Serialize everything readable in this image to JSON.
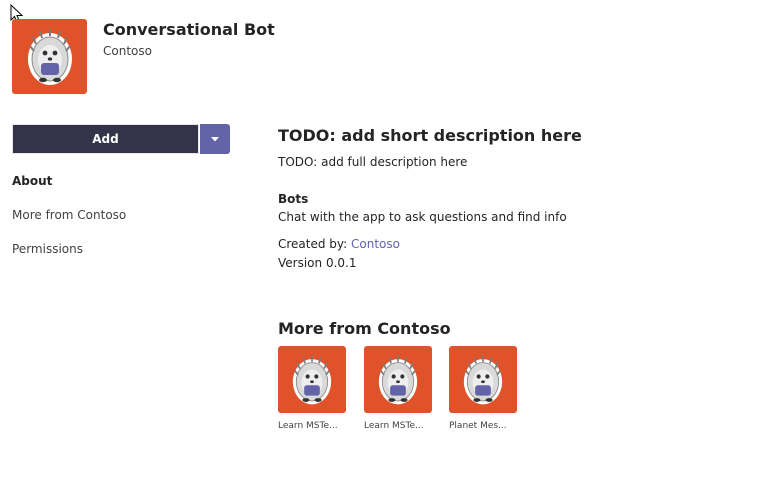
{
  "colors": {
    "brand": "#e0522a",
    "accent": "#6264a7",
    "button_dark": "#33344a",
    "link": "#6264a7"
  },
  "header": {
    "app_name": "Conversational Bot",
    "publisher": "Contoso",
    "icon": "hedgehog-mascot-icon"
  },
  "actions": {
    "add_label": "Add",
    "dropdown_icon": "caret-down-icon"
  },
  "nav": {
    "items": [
      {
        "label": "About",
        "active": true
      },
      {
        "label": "More from Contoso",
        "active": false
      },
      {
        "label": "Permissions",
        "active": false
      }
    ]
  },
  "about": {
    "short_description": "TODO: add short description here",
    "full_description": "TODO: add full description here",
    "bots_title": "Bots",
    "bots_description": "Chat with the app to ask questions and find info",
    "created_by_label": "Created by: ",
    "created_by_link": "Contoso",
    "version": "Version 0.0.1"
  },
  "more_from": {
    "title": "More from Contoso",
    "apps": [
      {
        "label": "Learn MSTe..."
      },
      {
        "label": "Learn MSTe..."
      },
      {
        "label": "Planet Mes..."
      }
    ]
  }
}
